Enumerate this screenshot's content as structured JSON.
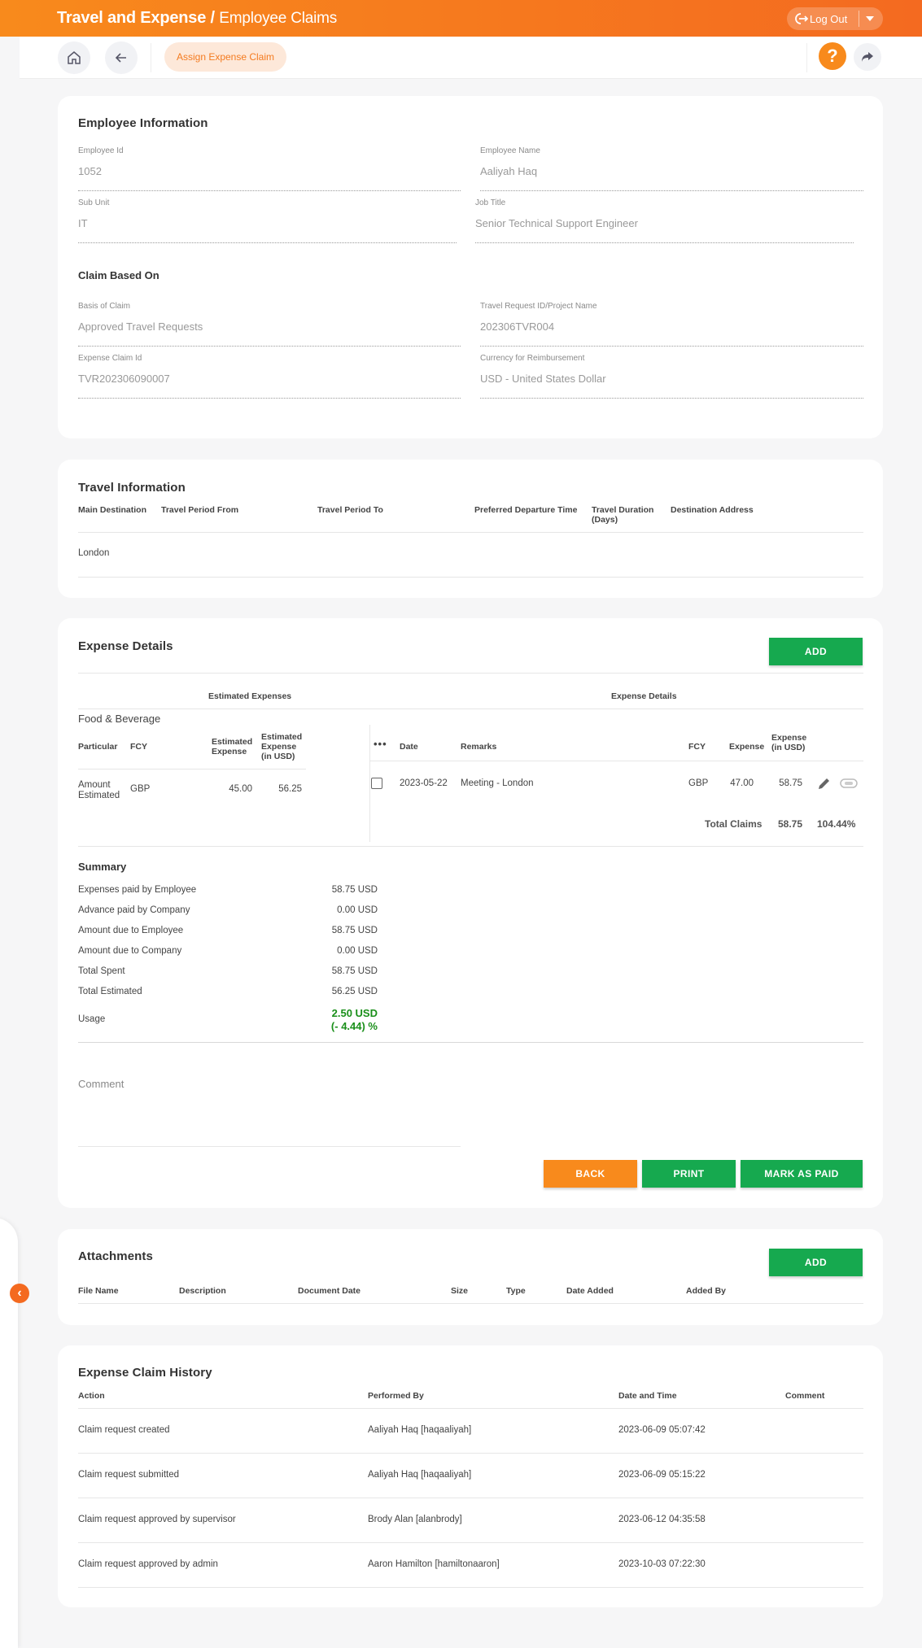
{
  "header": {
    "module": "Travel and Expense /",
    "page": "Employee Claims",
    "logout_label": "Log Out",
    "brand_color": "#f47b20"
  },
  "toolbar": {
    "assign_label": "Assign Expense Claim",
    "help_label": "?"
  },
  "employee_info": {
    "title": "Employee Information",
    "fields": [
      {
        "label": "Employee Id",
        "value": "1052"
      },
      {
        "label": "Employee Name",
        "value": "Aaliyah Haq"
      },
      {
        "label": "Sub Unit",
        "value": "IT"
      },
      {
        "label": "Job Title",
        "value": "Senior Technical Support Engineer"
      }
    ],
    "claim_title": "Claim Based On",
    "claim_fields": [
      {
        "label": "Basis of Claim",
        "value": "Approved Travel Requests"
      },
      {
        "label": "Travel Request ID/Project Name",
        "value": "202306TVR004"
      },
      {
        "label": "Expense Claim Id",
        "value": "TVR202306090007"
      },
      {
        "label": "Currency for Reimbursement",
        "value": "USD - United States Dollar"
      }
    ]
  },
  "travel_info": {
    "title": "Travel Information",
    "columns": [
      "Main Destination",
      "Travel Period From",
      "Travel Period To",
      "Preferred Departure Time",
      "Travel Duration (Days)",
      "Destination Address"
    ],
    "rows": [
      [
        "London",
        "",
        "",
        "",
        "",
        ""
      ]
    ]
  },
  "expense_details": {
    "title": "Expense Details",
    "add_label": "ADD",
    "estimated_heading": "Estimated Expenses",
    "details_heading": "Expense Details",
    "category": "Food & Beverage",
    "est_columns": [
      "Particular",
      "FCY",
      "Estimated Expense",
      "Estimated Expense (in USD)"
    ],
    "est_rows": [
      [
        "Amount Estimated",
        "GBP",
        "45.00",
        "56.25"
      ]
    ],
    "more_label": "•••",
    "exp_columns": [
      "Date",
      "Remarks",
      "FCY",
      "Expense",
      "Expense (in USD)"
    ],
    "exp_rows": [
      [
        "2023-05-22",
        "Meeting - London",
        "GBP",
        "47.00",
        "58.75"
      ]
    ],
    "total_label": "Total Claims",
    "total_value": "58.75",
    "total_percent": "104.44%"
  },
  "summary": {
    "title": "Summary",
    "items": [
      {
        "label": "Expenses paid by Employee",
        "value": "58.75 USD"
      },
      {
        "label": "Advance paid by Company",
        "value": "0.00 USD"
      },
      {
        "label": "Amount due to Employee",
        "value": "58.75 USD"
      },
      {
        "label": "Amount due to Company",
        "value": "0.00 USD"
      },
      {
        "label": "Total Spent",
        "value": "58.75 USD"
      },
      {
        "label": "Total Estimated",
        "value": "56.25 USD"
      }
    ],
    "usage_label": "Usage",
    "usage_value": "2.50 USD",
    "usage_percent": "(- 4.44) %",
    "usage_color": "#1a8f1a"
  },
  "comment": {
    "placeholder": "Comment"
  },
  "actions": {
    "back_label": "BACK",
    "print_label": "PRINT",
    "mark_paid_label": "MARK AS PAID"
  },
  "attachments": {
    "title": "Attachments",
    "add_label": "ADD",
    "columns": [
      "File Name",
      "Description",
      "Document Date",
      "Size",
      "Type",
      "Date Added",
      "Added By"
    ]
  },
  "history": {
    "title": "Expense Claim History",
    "columns": [
      "Action",
      "Performed By",
      "Date and Time",
      "Comment"
    ],
    "rows": [
      [
        "Claim request created",
        "Aaliyah Haq [haqaaliyah]",
        "2023-06-09 05:07:42",
        ""
      ],
      [
        "Claim request submitted",
        "Aaliyah Haq [haqaaliyah]",
        "2023-06-09 05:15:22",
        ""
      ],
      [
        "Claim request approved by supervisor",
        "Brody Alan [alanbrody]",
        "2023-06-12 04:35:58",
        ""
      ],
      [
        "Claim request approved by admin",
        "Aaron Hamilton [hamiltonaaron]",
        "2023-10-03 07:22:30",
        ""
      ]
    ]
  }
}
